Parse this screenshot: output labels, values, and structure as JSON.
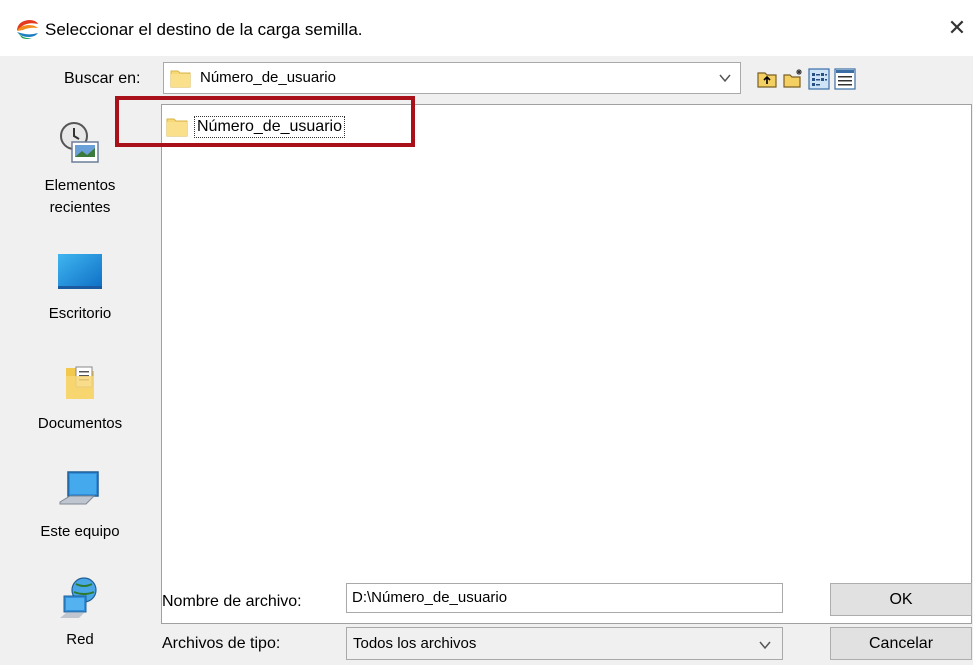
{
  "window": {
    "title": "Seleccionar el destino de la carga semilla.",
    "close_glyph": "✕"
  },
  "lookin": {
    "label": "Buscar en:",
    "value": "Número_de_usuario"
  },
  "toolbar": {
    "buttons": [
      "up-folder-icon",
      "new-folder-icon",
      "list-view-icon",
      "details-view-icon"
    ]
  },
  "places": [
    {
      "label": "Elementos\nrecientes",
      "icon": "recent-items-icon"
    },
    {
      "label": "Escritorio",
      "icon": "desktop-icon"
    },
    {
      "label": "Documentos",
      "icon": "documents-icon"
    },
    {
      "label": "Este equipo",
      "icon": "this-pc-icon"
    },
    {
      "label": "Red",
      "icon": "network-icon"
    }
  ],
  "files": [
    {
      "name": "Número_de_usuario",
      "icon": "folder-icon"
    }
  ],
  "filename": {
    "label": "Nombre de archivo:",
    "value": "D:\\Número_de_usuario"
  },
  "filetype": {
    "label": "Archivos de tipo:",
    "value": "Todos los archivos"
  },
  "buttons": {
    "ok": "OK",
    "cancel": "Cancelar"
  },
  "colors": {
    "highlight": "#a8111a",
    "folder": "#f8d775"
  }
}
